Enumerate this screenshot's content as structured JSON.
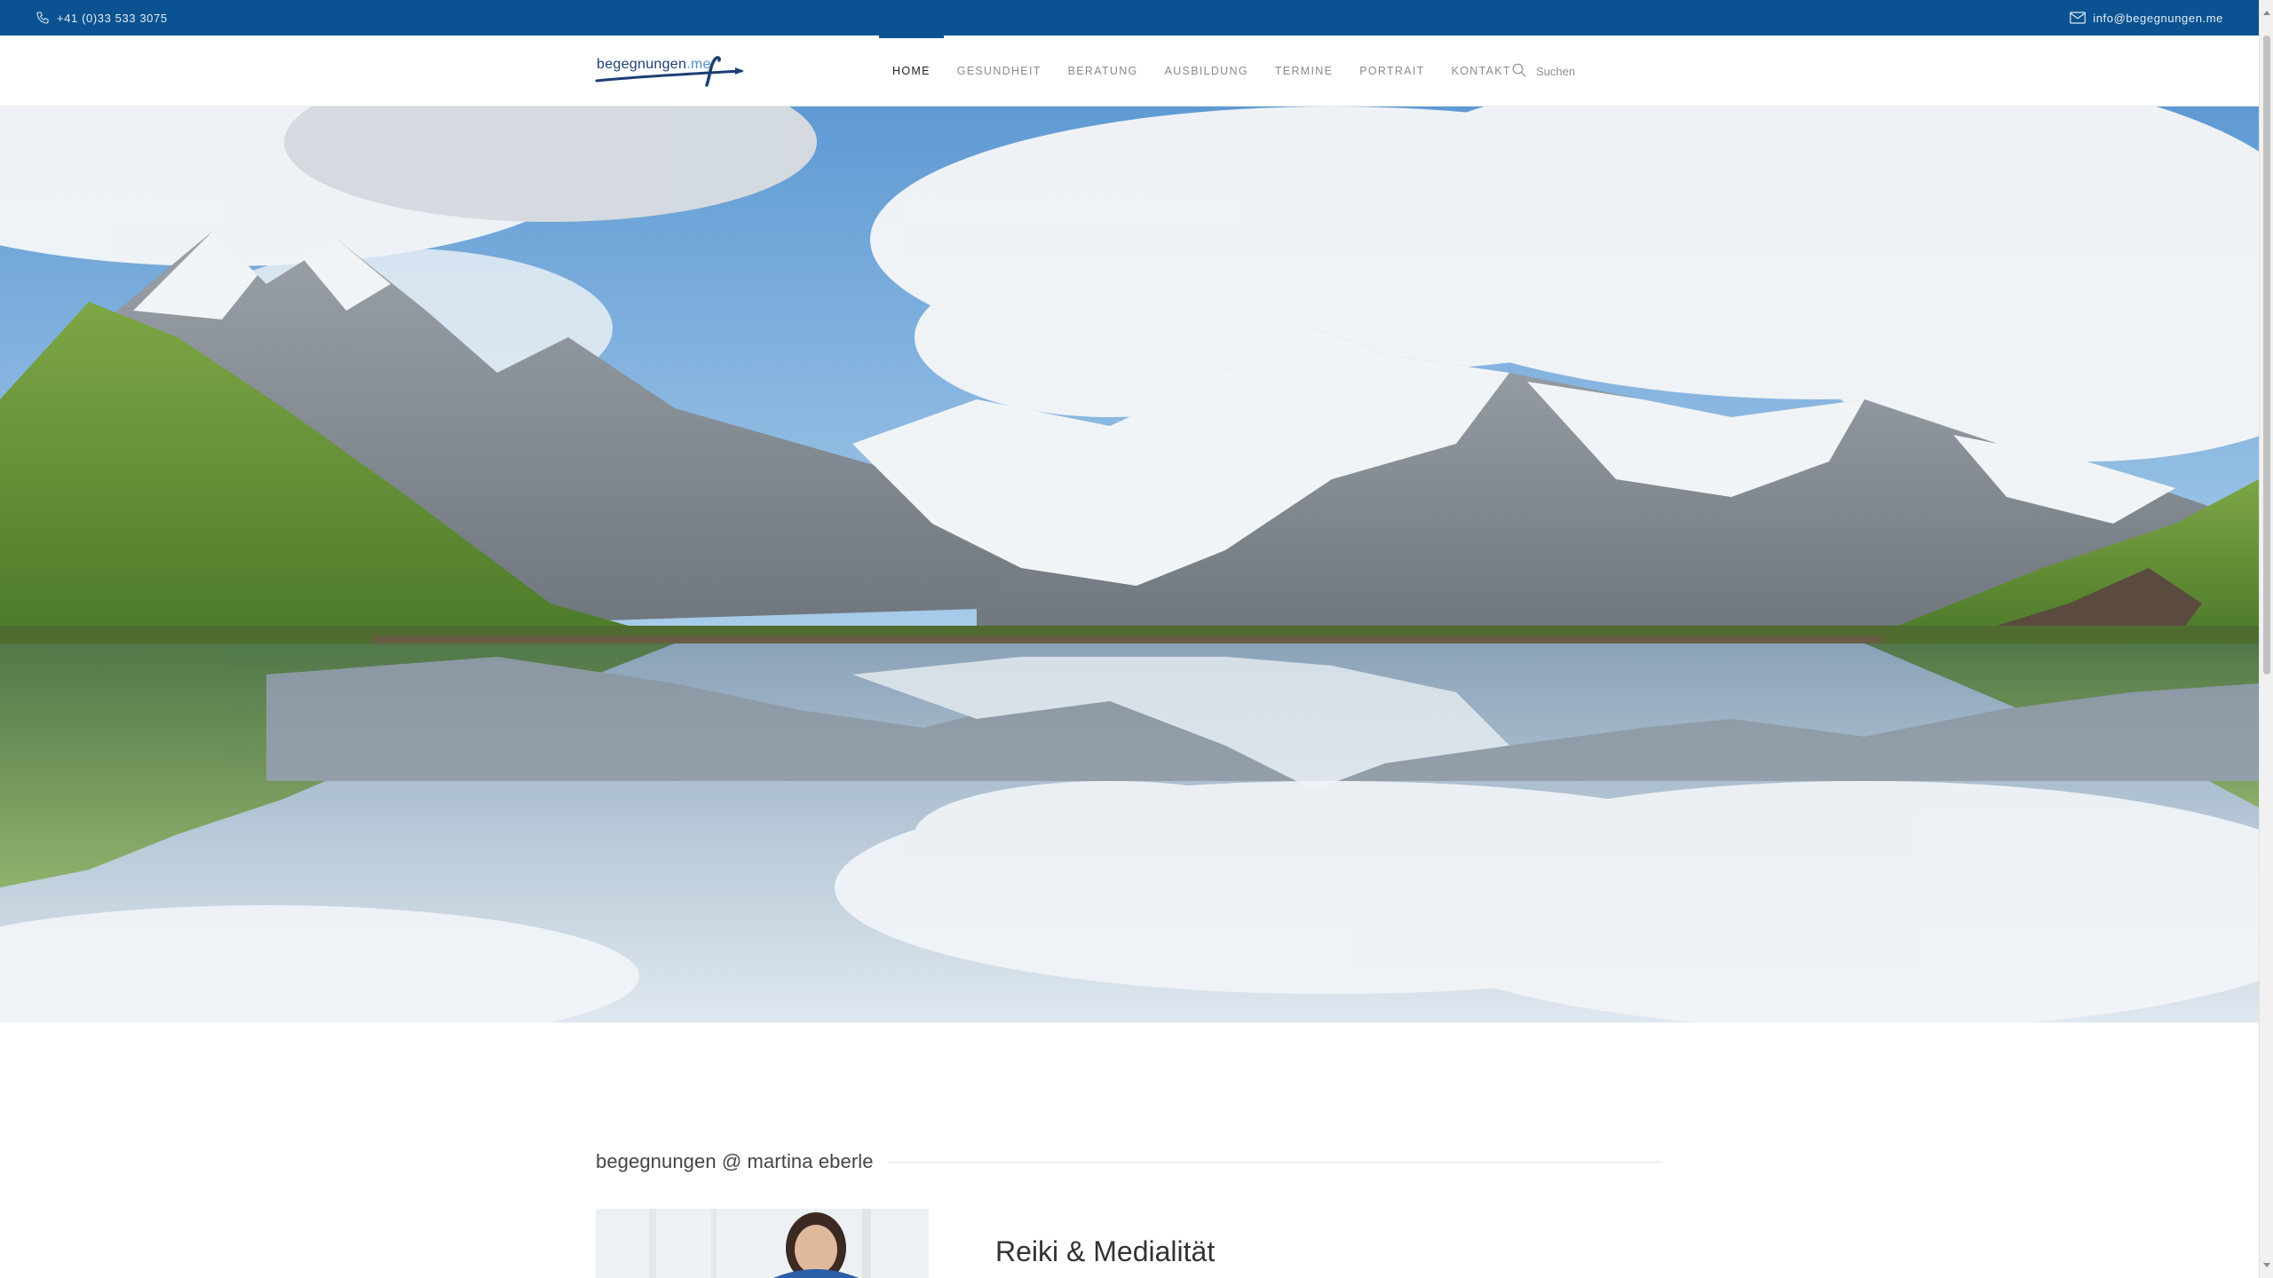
{
  "topbar": {
    "phone": "+41 (0)33 533 3075",
    "email": "info@begegnungen.me",
    "phone_icon": "phone-icon",
    "email_icon": "envelope-icon"
  },
  "header": {
    "logo_text": "begegnungen",
    "logo_tld": ".me",
    "nav": [
      {
        "label": "HOME",
        "active": true
      },
      {
        "label": "GESUNDHEIT",
        "active": false
      },
      {
        "label": "BERATUNG",
        "active": false
      },
      {
        "label": "AUSBILDUNG",
        "active": false
      },
      {
        "label": "TERMINE",
        "active": false
      },
      {
        "label": "PORTRAIT",
        "active": false
      },
      {
        "label": "KONTAKT",
        "active": false
      }
    ],
    "search": {
      "placeholder": "Suchen",
      "icon": "search-icon"
    }
  },
  "hero": {
    "image": "alpine-lake-mountain-reflection"
  },
  "content": {
    "section_title": "begegnungen @ martina eberle",
    "card_title": "Reiki & Medialität"
  },
  "colors": {
    "brand": "#0a5291",
    "nav_text": "#8a8a8a",
    "nav_active": "#222222"
  }
}
